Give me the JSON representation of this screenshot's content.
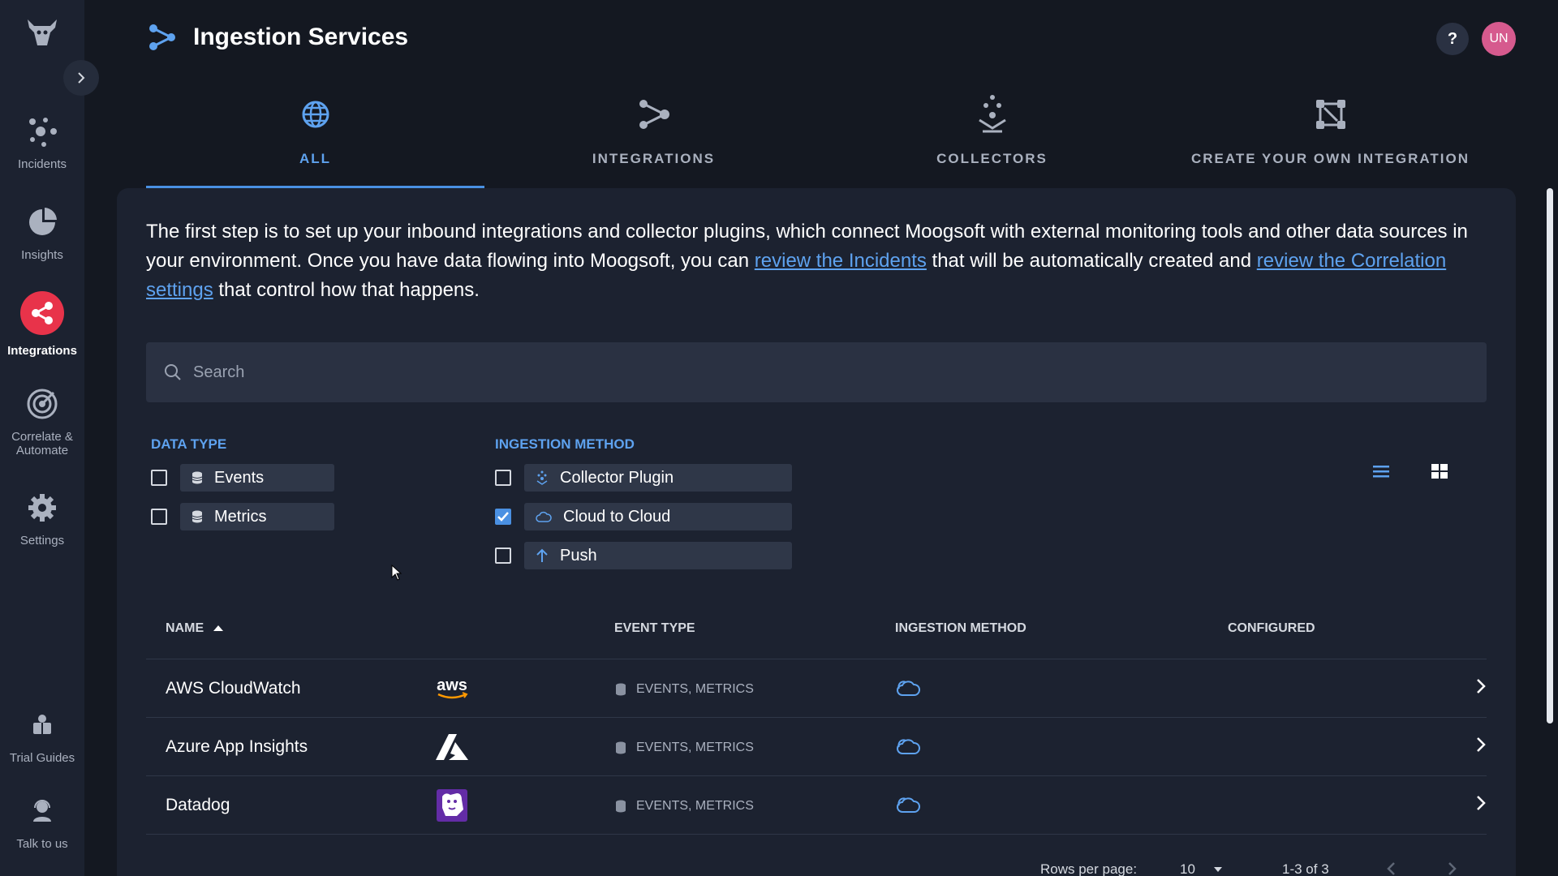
{
  "app": {
    "page_title": "Ingestion Services",
    "help_label": "?",
    "avatar_initials": "UN"
  },
  "sidebar": {
    "items": [
      {
        "label": "Incidents",
        "icon": "incidents-icon"
      },
      {
        "label": "Insights",
        "icon": "pie-chart-icon"
      },
      {
        "label": "Integrations",
        "icon": "integrations-icon",
        "active": true
      },
      {
        "label": "Correlate & Automate",
        "icon": "target-icon"
      },
      {
        "label": "Settings",
        "icon": "gear-icon"
      },
      {
        "label": "Trial Guides",
        "icon": "guides-icon"
      },
      {
        "label": "Talk to us",
        "icon": "support-agent-icon"
      }
    ],
    "item_correlate_line1": "Correlate &",
    "item_correlate_line2": "Automate"
  },
  "tabs": [
    {
      "label": "ALL",
      "icon": "globe-icon",
      "active": true
    },
    {
      "label": "INTEGRATIONS",
      "icon": "integrations-flow-icon"
    },
    {
      "label": "COLLECTORS",
      "icon": "collector-icon"
    },
    {
      "label": "CREATE YOUR OWN INTEGRATION",
      "icon": "custom-integration-icon"
    }
  ],
  "intro": {
    "text_before_link1": "The first step is to set up your inbound integrations and collector plugins, which connect Moogsoft with external monitoring tools and other data sources in your environment. Once you have data flowing into Moogsoft, you can ",
    "link1": "review the Incidents",
    "text_between": " that will be automatically created and ",
    "link2": "review the Correlation settings",
    "text_after": " that control how that happens."
  },
  "search": {
    "placeholder": "Search"
  },
  "filters": {
    "data_type": {
      "title": "DATA TYPE",
      "options": [
        {
          "label": "Events",
          "checked": false
        },
        {
          "label": "Metrics",
          "checked": false
        }
      ]
    },
    "ingestion_method": {
      "title": "INGESTION METHOD",
      "options": [
        {
          "label": "Collector Plugin",
          "checked": false
        },
        {
          "label": "Cloud to Cloud",
          "checked": true
        },
        {
          "label": "Push",
          "checked": false
        }
      ]
    },
    "view_mode": "list"
  },
  "table": {
    "columns": [
      "NAME",
      "EVENT TYPE",
      "INGESTION METHOD",
      "CONFIGURED"
    ],
    "sort": {
      "column": "NAME",
      "direction": "asc"
    },
    "rows": [
      {
        "name": "AWS CloudWatch",
        "logo": "aws-logo",
        "logo_text": "aws",
        "event_type": "EVENTS, METRICS",
        "ingestion_method": "cloud-icon",
        "configured": ""
      },
      {
        "name": "Azure App Insights",
        "logo": "azure-logo",
        "event_type": "EVENTS, METRICS",
        "ingestion_method": "cloud-icon",
        "configured": ""
      },
      {
        "name": "Datadog",
        "logo": "datadog-logo",
        "event_type": "EVENTS, METRICS",
        "ingestion_method": "cloud-icon",
        "configured": ""
      }
    ]
  },
  "pagination": {
    "rows_per_page_label": "Rows per page:",
    "rows_per_page": "10",
    "range": "1-3 of 3"
  },
  "colors": {
    "accent": "#4a90e2",
    "active_nav": "#e8334a",
    "avatar": "#d65a8e",
    "background": "#141821",
    "panel": "#1c2230"
  }
}
